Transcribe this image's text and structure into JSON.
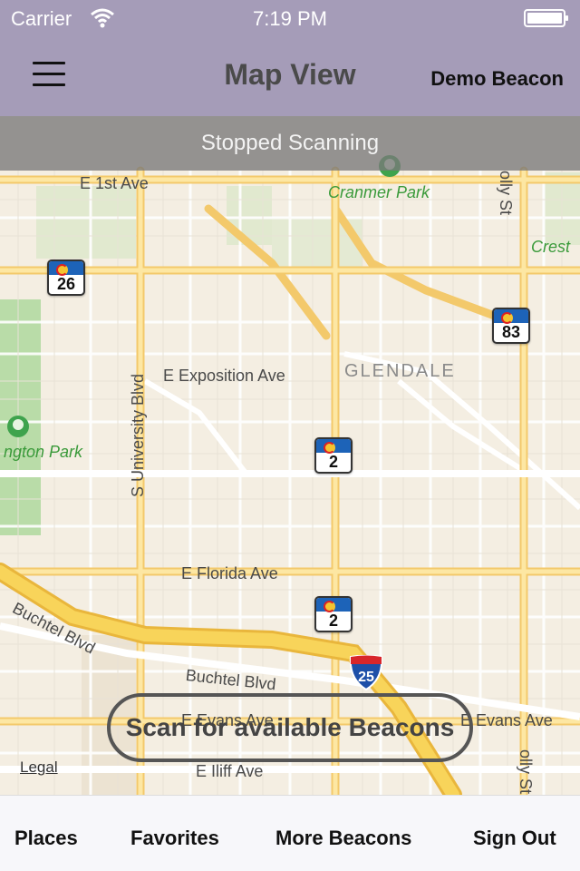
{
  "status_bar": {
    "carrier": "Carrier",
    "time": "7:19 PM",
    "wifi_icon": "wifi-icon",
    "battery_icon": "battery-icon"
  },
  "nav": {
    "menu_icon": "menu-icon",
    "title": "Map View",
    "right_label": "Demo Beacon"
  },
  "banner": {
    "text": "Stopped Scanning"
  },
  "map": {
    "streets": {
      "e_1st_ave": "E 1st Ave",
      "e_exposition_ave": "E Exposition Ave",
      "s_university_blvd": "S University Blvd",
      "e_florida_ave": "E Florida Ave",
      "buchtel_blvd_left": "Buchtel Blvd",
      "buchtel_blvd_right": "Buchtel Blvd",
      "e_evans_ave": "E Evans Ave",
      "e_evans_ave_right": "E Evans Ave",
      "e_iliff_ave": "E Iliff Ave",
      "holly_st_top": "olly St",
      "holly_st_bottom": "olly St"
    },
    "parks": {
      "cranmer_park": "Cranmer Park",
      "crest": "Crest",
      "washington_park": "ngton Park"
    },
    "areas": {
      "glendale": "GLENDALE"
    },
    "shields": {
      "s26": "26",
      "s83": "83",
      "s2_upper": "2",
      "s2_lower": "2",
      "i25": "25"
    },
    "legal": "Legal",
    "pin_color": "#e8262b"
  },
  "scan_button": {
    "label": "Scan for available Beacons"
  },
  "tabs": [
    {
      "label": "Places"
    },
    {
      "label": "Favorites"
    },
    {
      "label": "More Beacons"
    },
    {
      "label": "Sign Out"
    }
  ],
  "colors": {
    "nav_bg": "#a59cb8",
    "banner_bg": "#787878",
    "major_road": "#f7d56a",
    "highway": "#f5c542",
    "park": "#a9d79b"
  }
}
